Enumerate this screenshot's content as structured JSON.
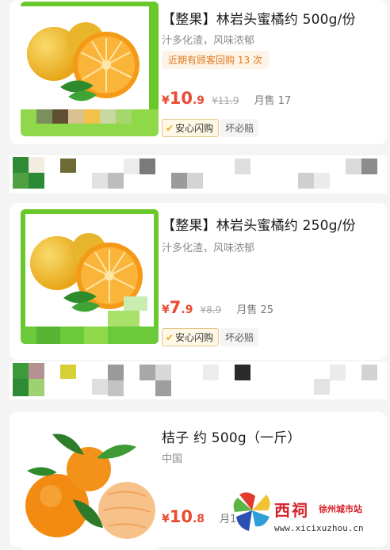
{
  "products": [
    {
      "title": "【整果】林岩头蜜橘约 500g/份",
      "subtitle": "汁多化渣，风味浓郁",
      "tag": "近期有顾客回购 13 次",
      "price_symbol": "¥",
      "price_int": "10",
      "price_dec": ".9",
      "orig_price": "¥11.9",
      "sold": "月售 17",
      "badge_check": "✔",
      "badge_main": "安心闪购",
      "badge_sub": "坏必赔"
    },
    {
      "title": "【整果】林岩头蜜橘约 250g/份",
      "subtitle": "汁多化渣，风味浓郁",
      "price_symbol": "¥",
      "price_int": "7",
      "price_dec": ".9",
      "orig_price": "¥8.9",
      "sold": "月售 25",
      "badge_check": "✔",
      "badge_main": "安心闪购",
      "badge_sub": "坏必赔"
    },
    {
      "title": "桔子 约 500g（一斤）",
      "subtitle": "中国",
      "price_symbol": "¥",
      "price_int": "10",
      "price_dec": ".8",
      "sold": "月1"
    }
  ],
  "watermark": {
    "name": "西祠",
    "site": "徐州城市站",
    "url": "www.xicixuzhou.cn"
  },
  "colors": {
    "price": "#e94b33",
    "frame_green": "#69c82a",
    "tag_orange": "#e07a20",
    "watermark_red": "#d6222a"
  }
}
